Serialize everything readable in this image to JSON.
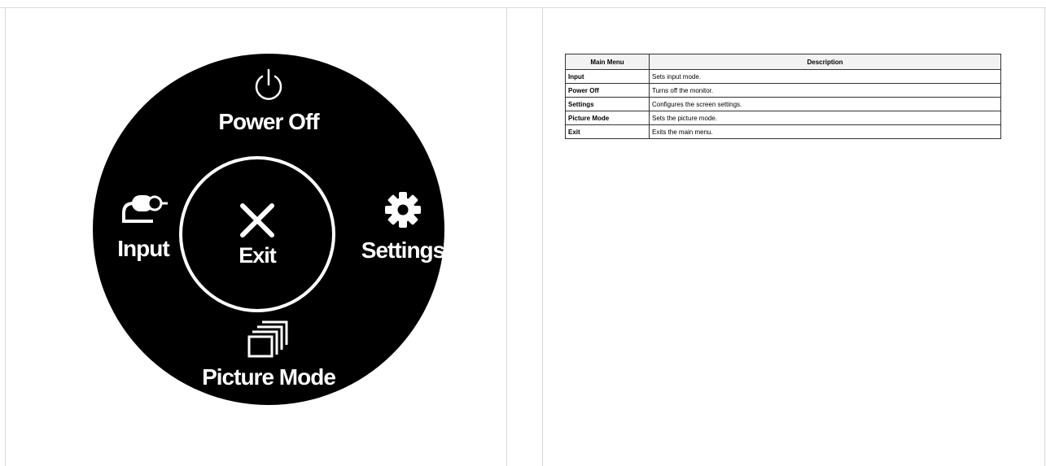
{
  "menu": {
    "power_off": {
      "label": "Power Off",
      "icon": "power-icon"
    },
    "input": {
      "label": "Input",
      "icon": "input-plug-icon"
    },
    "exit": {
      "label": "Exit",
      "icon": "close-icon"
    },
    "settings": {
      "label": "Settings",
      "icon": "gear-icon"
    },
    "picture_mode": {
      "label": "Picture Mode",
      "icon": "stacked-windows-icon"
    }
  },
  "table": {
    "headers": [
      "Main Menu",
      "Description"
    ],
    "rows": [
      {
        "menu": "Input",
        "description": "Sets input mode."
      },
      {
        "menu": "Power Off",
        "description": "Turns off the monitor."
      },
      {
        "menu": "Settings",
        "description": "Configures the screen settings."
      },
      {
        "menu": "Picture Mode",
        "description": "Sets the picture mode."
      },
      {
        "menu": "Exit",
        "description": "Exits the main menu."
      }
    ]
  },
  "colors": {
    "disc": "#000000",
    "foreground": "#ffffff",
    "header_bg": "#f2f2f2"
  }
}
